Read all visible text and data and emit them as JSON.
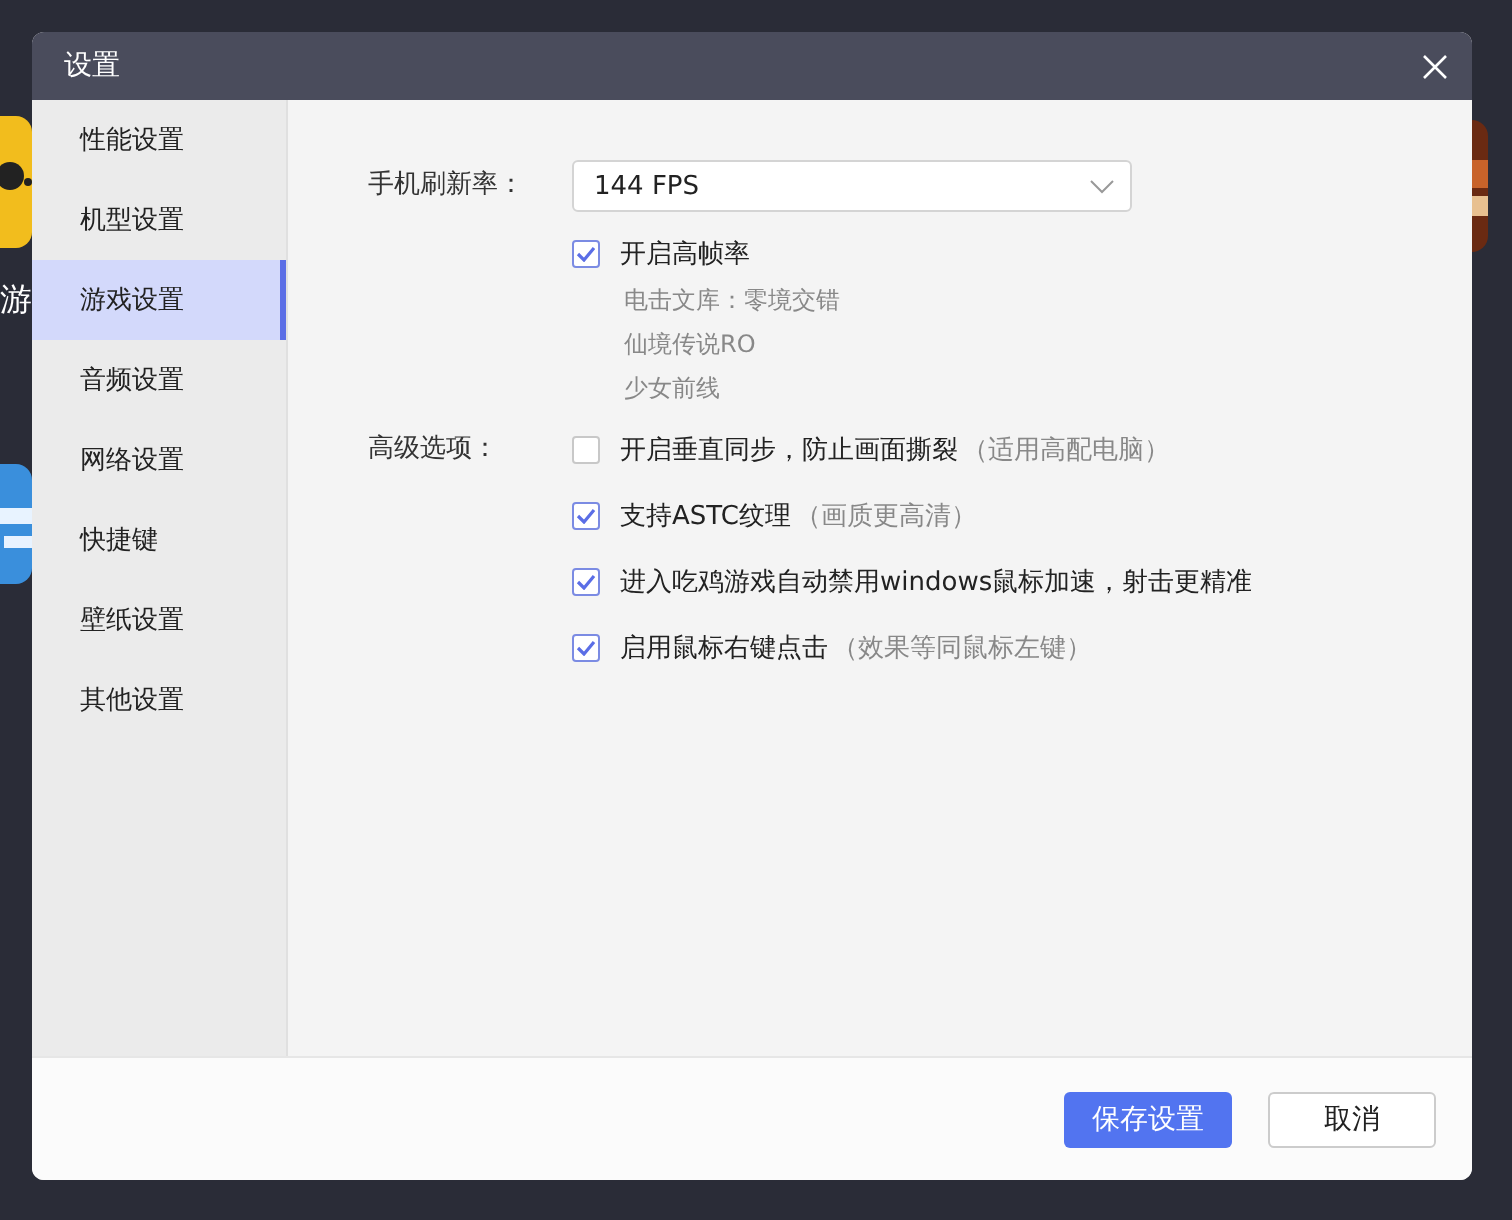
{
  "desktop": {
    "labels": [
      "游"
    ]
  },
  "window": {
    "title": "设置"
  },
  "sidebar": {
    "items": [
      {
        "label": "性能设置",
        "selected": false
      },
      {
        "label": "机型设置",
        "selected": false
      },
      {
        "label": "游戏设置",
        "selected": true
      },
      {
        "label": "音频设置",
        "selected": false
      },
      {
        "label": "网络设置",
        "selected": false
      },
      {
        "label": "快捷键",
        "selected": false
      },
      {
        "label": "壁纸设置",
        "selected": false
      },
      {
        "label": "其他设置",
        "selected": false
      }
    ]
  },
  "refresh_rate": {
    "label": "手机刷新率：",
    "value": "144 FPS",
    "high_fps": {
      "label": "开启高帧率",
      "checked": true
    },
    "supported_games": [
      "电击文库：零境交错",
      "仙境传说RO",
      "少女前线"
    ]
  },
  "advanced": {
    "label": "高级选项：",
    "options": [
      {
        "label": "开启垂直同步，防止画面撕裂",
        "note": "（适用高配电脑）",
        "checked": false
      },
      {
        "label": "支持ASTC纹理",
        "note": "（画质更高清）",
        "checked": true
      },
      {
        "label": "进入吃鸡游戏自动禁用windows鼠标加速，射击更精准",
        "checked": true
      },
      {
        "label": "启用鼠标右键点击",
        "note": "（效果等同鼠标左键）",
        "checked": true
      }
    ]
  },
  "buttons": [
    {
      "label": "保存设置",
      "kind": "primary"
    },
    {
      "label": "取消",
      "kind": "secondary"
    }
  ]
}
